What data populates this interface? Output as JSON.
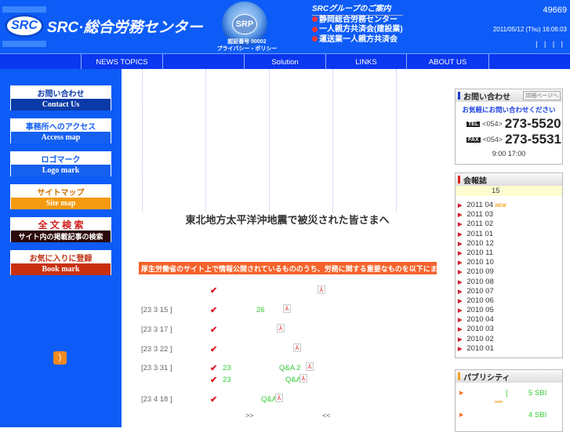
{
  "header": {
    "logo_mark": "SRC",
    "site_name": "SRC·総合労務センター",
    "srp_mark": "SRP",
    "srp_number": "認証番号 00002",
    "privacy_policy": "プライバシー・ポリシー",
    "group_title": "SRCグループのご案内",
    "group_links": [
      "静岡総合労務センター",
      "一人親方共済会(建設業)",
      "運送業一人親方共済会"
    ],
    "counter": "49669",
    "datetime": "2011/05/12 (Thu) 16:06:03",
    "pipes": "| | | |"
  },
  "nav": [
    "NEWS TOPICS",
    "",
    "Solution",
    "LINKS",
    "ABOUT US",
    ""
  ],
  "sidebar": [
    {
      "top": "お問い合わせ",
      "bottom": "Contact Us",
      "color": "#0a3aa8",
      "tcolor": "#0a3aa8"
    },
    {
      "top": "事務所へのアクセス",
      "bottom": "Access map",
      "color": "#1560f0",
      "tcolor": "#1560f0"
    },
    {
      "top": "ロゴマーク",
      "bottom": "Logo mark",
      "color": "#1560f0",
      "tcolor": "#1560f0"
    },
    {
      "top": "サイトマップ",
      "bottom": "Site map",
      "color": "#f59a10",
      "tcolor": "#d07000"
    },
    {
      "top": "全 文 検 索",
      "bottom": "サイト内の掲載記事の検索",
      "color": "#2a0808",
      "tcolor": "#d02020"
    },
    {
      "top": "お気に入りに登録",
      "bottom": "Book mark",
      "color": "#c83010",
      "tcolor": "#c03010"
    }
  ],
  "main": {
    "headline": "東北地方太平洋沖地震で被災された皆さまへ",
    "notice": "厚生労働省のサイト上で情報公開されているもののうち、労務に関する重要なものを以下にまとめています。",
    "rows": [
      {
        "date": "",
        "green": "",
        "green2": ""
      },
      {
        "date": "[23 3 15 ]",
        "green": "26",
        "green2": ""
      },
      {
        "date": "[23 3 17 ]",
        "green": "",
        "green2": ""
      },
      {
        "date": "[23 3 22 ]",
        "green": "",
        "green2": ""
      },
      {
        "date": "[23 3 31 ]",
        "green": "23",
        "green2": "Q&A 2"
      },
      {
        "date": "",
        "green": "23",
        "green2": "Q&A"
      },
      {
        "date": "[23 4 18 ]",
        "green": "",
        "green2": "Q&A"
      }
    ],
    "next": ">>",
    "prev": "<<"
  },
  "contact": {
    "title": "お問い合わせ",
    "detail_button": "詳細ページへ",
    "lead": "お気軽にお問い合わせください",
    "tel_label": "TEL",
    "tel_area": "<054>",
    "tel": "273-5520",
    "fax_label": "FAX",
    "fax_area": "<054>",
    "fax": "273-5531",
    "hours": "9:00 17:00"
  },
  "bulletin": {
    "title": "会報誌",
    "issue": "15",
    "new_badge": "NEW",
    "archives": [
      "2011 04",
      "2011 03",
      "2011 02",
      "2011 01",
      "2010 12",
      "2010 11",
      "2010 10",
      "2010 09",
      "2010 08",
      "2010 07",
      "2010 06",
      "2010 05",
      "2010 04",
      "2010 03",
      "2010 02",
      "2010 01"
    ]
  },
  "publicity": {
    "title": "パブリシティ",
    "items": [
      {
        "bracket": "[",
        "text": "5  SBI"
      },
      {
        "bracket": "",
        "text": "4  SBI"
      }
    ],
    "new_badge": "new"
  }
}
